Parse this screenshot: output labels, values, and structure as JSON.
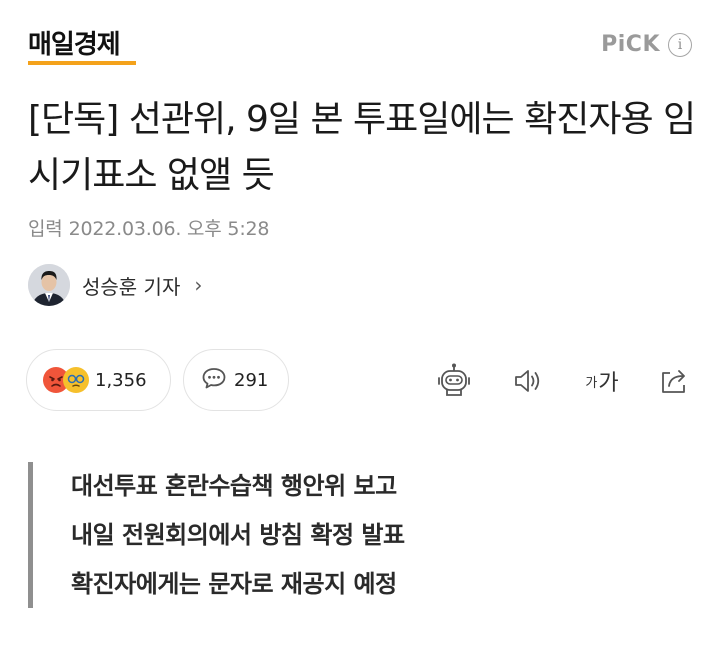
{
  "header": {
    "brand": "매일경제",
    "pick_label": "PiCK",
    "info_glyph": "i",
    "brand_accent_color": "#f4a21b"
  },
  "article": {
    "headline": "[단독] 선관위, 9일 본 투표일에는 확진자용 임시기표소 없앨 듯",
    "date_label": "입력",
    "date_value": "2022.03.06. 오후 5:28",
    "author": {
      "name": "성승훈 기자",
      "chevron": "›"
    },
    "summary": [
      "대선투표 혼란수습책 행안위 보고",
      "내일 전원회의에서 방침 확정 발표",
      "확진자에게는 문자로 재공지 예정"
    ]
  },
  "actions": {
    "reactions": {
      "icons": [
        "angry-emoji-icon",
        "sad-emoji-icon"
      ],
      "count": "1,356"
    },
    "comments": {
      "icon": "comment-icon",
      "count": "291"
    },
    "tools": [
      {
        "name": "robot-summary-icon"
      },
      {
        "name": "speaker-icon"
      },
      {
        "name": "font-size-icon",
        "small": "가",
        "large": "가"
      },
      {
        "name": "share-icon"
      }
    ]
  }
}
